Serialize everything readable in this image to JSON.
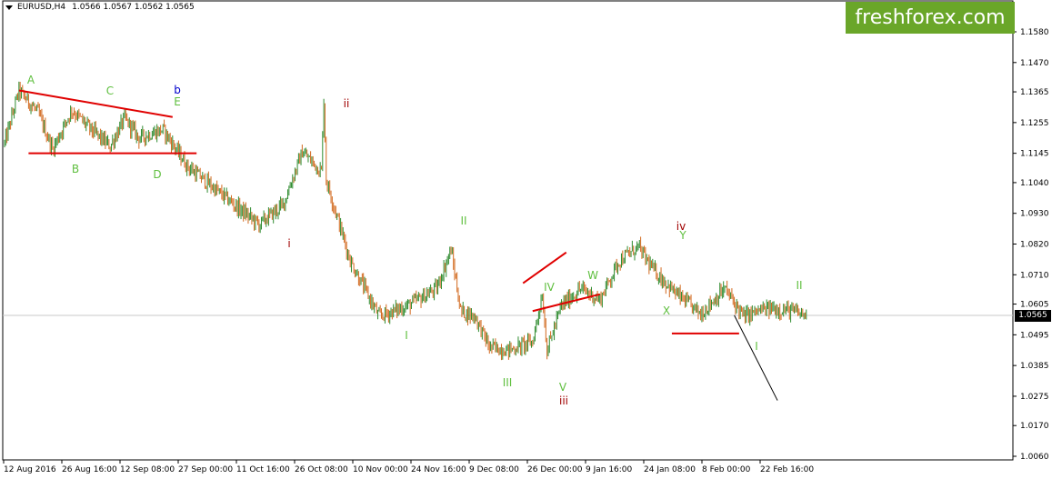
{
  "header": {
    "symbol": "EURUSD,H4",
    "ohlc": "1.0566 1.0567 1.0562 1.0565"
  },
  "logo": "freshforex.com",
  "current_price": "1.0565",
  "colors": {
    "up_candle": "#2e8b2e",
    "down_candle": "#d2691e",
    "trendline": "#e00000",
    "wave_green": "#5fbf3f",
    "wave_darkred": "#a00000",
    "wave_blue": "#0000cc",
    "forecast": "#000000"
  },
  "chart_data": {
    "type": "candlestick",
    "title": "EURUSD,H4",
    "y_ticks": [
      "1.1580",
      "1.1470",
      "1.1365",
      "1.1255",
      "1.1145",
      "1.1040",
      "1.0930",
      "1.0820",
      "1.0710",
      "1.0605",
      "1.0495",
      "1.0385",
      "1.0275",
      "1.0170",
      "1.0060"
    ],
    "x_ticks": [
      "12 Aug 2016",
      "26 Aug 16:00",
      "12 Sep 08:00",
      "27 Sep 00:00",
      "11 Oct 16:00",
      "26 Oct 08:00",
      "10 Nov 00:00",
      "24 Nov 16:00",
      "9 Dec 08:00",
      "26 Dec 00:00",
      "9 Jan 16:00",
      "24 Jan 08:00",
      "8 Feb 00:00",
      "22 Feb 16:00"
    ],
    "ylim": [
      1.006,
      1.158
    ],
    "price_path": [
      [
        0,
        1.118
      ],
      [
        3,
        1.137
      ],
      [
        7,
        1.129
      ],
      [
        10,
        1.116
      ],
      [
        14,
        1.13
      ],
      [
        18,
        1.123
      ],
      [
        22,
        1.117
      ],
      [
        25,
        1.127
      ],
      [
        28,
        1.12
      ],
      [
        33,
        1.123
      ],
      [
        38,
        1.11
      ],
      [
        45,
        1.1
      ],
      [
        53,
        1.089
      ],
      [
        58,
        1.096
      ],
      [
        62,
        1.115
      ],
      [
        66,
        1.108
      ],
      [
        66.5,
        1.134
      ],
      [
        67,
        1.105
      ],
      [
        72,
        1.076
      ],
      [
        78,
        1.056
      ],
      [
        84,
        1.06
      ],
      [
        90,
        1.066
      ],
      [
        93,
        1.08
      ],
      [
        95,
        1.058
      ],
      [
        98,
        1.056
      ],
      [
        101,
        1.045
      ],
      [
        105,
        1.044
      ],
      [
        110,
        1.047
      ],
      [
        112,
        1.064
      ],
      [
        113,
        1.044
      ],
      [
        116,
        1.06
      ],
      [
        120,
        1.066
      ],
      [
        124,
        1.062
      ],
      [
        128,
        1.076
      ],
      [
        132,
        1.081
      ],
      [
        135,
        1.073
      ],
      [
        140,
        1.064
      ],
      [
        145,
        1.057
      ],
      [
        150,
        1.066
      ],
      [
        154,
        1.056
      ],
      [
        157,
        1.058
      ],
      [
        160,
        1.059
      ],
      [
        164,
        1.058
      ],
      [
        167,
        1.0565
      ]
    ],
    "annotations": [
      {
        "text": "A",
        "color": "green"
      },
      {
        "text": "B",
        "color": "green"
      },
      {
        "text": "C",
        "color": "green"
      },
      {
        "text": "D",
        "color": "green"
      },
      {
        "text": "E",
        "color": "green"
      },
      {
        "text": "b",
        "color": "blue"
      },
      {
        "text": "i",
        "color": "darkred"
      },
      {
        "text": "ii",
        "color": "darkred"
      },
      {
        "text": "iii",
        "color": "darkred"
      },
      {
        "text": "iv",
        "color": "darkred"
      },
      {
        "text": "I",
        "color": "green"
      },
      {
        "text": "II",
        "color": "green"
      },
      {
        "text": "III",
        "color": "green"
      },
      {
        "text": "IV",
        "color": "green"
      },
      {
        "text": "V",
        "color": "green"
      },
      {
        "text": "W",
        "color": "green"
      },
      {
        "text": "X",
        "color": "green"
      },
      {
        "text": "Y",
        "color": "green"
      },
      {
        "text": "I",
        "color": "green"
      },
      {
        "text": "II",
        "color": "green"
      }
    ],
    "trendlines": [
      {
        "name": "triangle-upper",
        "from": [
          3,
          1.137
        ],
        "to": [
          35,
          1.1275
        ]
      },
      {
        "name": "triangle-lower",
        "from": [
          5,
          1.1145
        ],
        "to": [
          40,
          1.1145
        ]
      },
      {
        "name": "wedge-upper",
        "from": [
          108,
          1.068
        ],
        "to": [
          117,
          1.079
        ]
      },
      {
        "name": "wedge-lower",
        "from": [
          110,
          1.058
        ],
        "to": [
          124,
          1.064
        ]
      },
      {
        "name": "support",
        "from": [
          139,
          1.05
        ],
        "to": [
          153,
          1.05
        ]
      }
    ],
    "forecast": {
      "from": [
        152,
        1.0565
      ],
      "to": [
        161,
        1.026
      ]
    }
  }
}
